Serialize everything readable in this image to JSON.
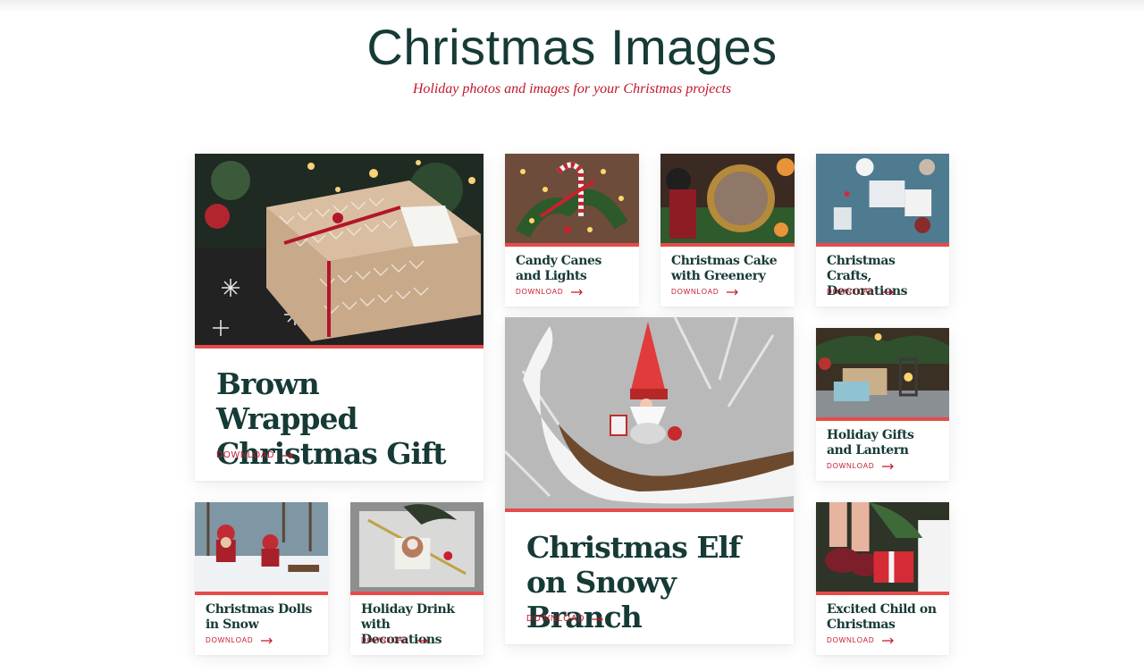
{
  "header": {
    "title": "Christmas Images",
    "subtitle": "Holiday photos and images for your Christmas projects"
  },
  "download_label": "DOWNLOAD",
  "cards": {
    "brown_gift": {
      "title": "Brown Wrapped Christmas Gift",
      "action": "DOWNLOAD"
    },
    "candy_canes": {
      "title": "Candy Canes and Lights",
      "action": "DOWNLOAD"
    },
    "christmas_cake": {
      "title": "Christmas Cake with Greenery",
      "action": "DOWNLOAD"
    },
    "crafts": {
      "title": "Christmas Crafts, Decorations",
      "action": "DOWNLOAD"
    },
    "elf": {
      "title": "Christmas Elf on Snowy Branch",
      "action": "DOWNLOAD"
    },
    "gifts_lantern": {
      "title": "Holiday Gifts and Lantern",
      "action": "DOWNLOAD"
    },
    "dolls": {
      "title": "Christmas Dolls in Snow",
      "action": "DOWNLOAD"
    },
    "drink": {
      "title": "Holiday Drink with Decorations",
      "action": "DOWNLOAD"
    },
    "child": {
      "title": "Excited Child on Christmas",
      "action": "DOWNLOAD"
    }
  },
  "colors": {
    "title": "#163a36",
    "accent": "#c3172b",
    "image_border": "#e54b4b"
  },
  "icons": {
    "download_arrow": "arrow-right-icon"
  }
}
